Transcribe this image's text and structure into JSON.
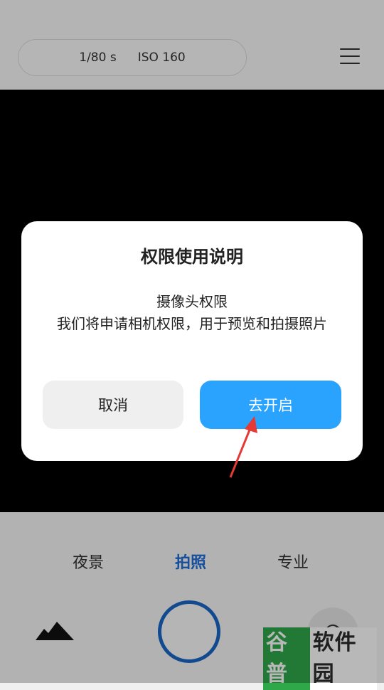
{
  "camera_top": {
    "shutter_speed": "1/80 s",
    "iso": "ISO 160",
    "menu_icon": "hamburger-menu-icon"
  },
  "modes": {
    "night": "夜景",
    "photo": "拍照",
    "pro": "专业",
    "active": "拍照"
  },
  "bottom_controls": {
    "gallery_icon": "mountains-icon",
    "switch_icon": "camera-switch-icon"
  },
  "dialog": {
    "title": "权限使用说明",
    "subtitle": "摄像头权限",
    "body": "我们将申请相机权限，用于预览和拍摄照片",
    "cancel_label": "取消",
    "ok_label": "去开启"
  },
  "watermark": {
    "part1": "谷普",
    "part2": "软件园"
  },
  "colors": {
    "accent_blue": "#2aa3ff",
    "active_mode": "#1f6fd8",
    "arrow_red": "#e53935",
    "watermark_green": "#2fa84a"
  }
}
